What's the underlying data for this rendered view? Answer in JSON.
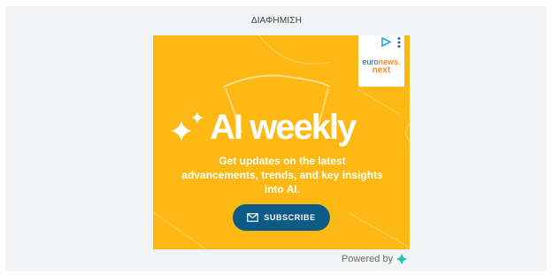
{
  "ad_label": "ΔΙΑΦΗΜΙΣΗ",
  "brand": {
    "line1a": "euro",
    "line1b": "news.",
    "line2": "next"
  },
  "creative": {
    "headline": "AI weekly",
    "subtext": "Get updates on the latest advancements, trends, and key insights into AI.",
    "cta_label": "SUBSCRIBE"
  },
  "footer": {
    "powered_by": "Powered by"
  },
  "colors": {
    "ad_background": "#fdb813",
    "cta_background": "#0e5a86",
    "brand_blue": "#0a5ea8",
    "brand_orange": "#f28c28",
    "panel_background": "#f1f3f4"
  }
}
